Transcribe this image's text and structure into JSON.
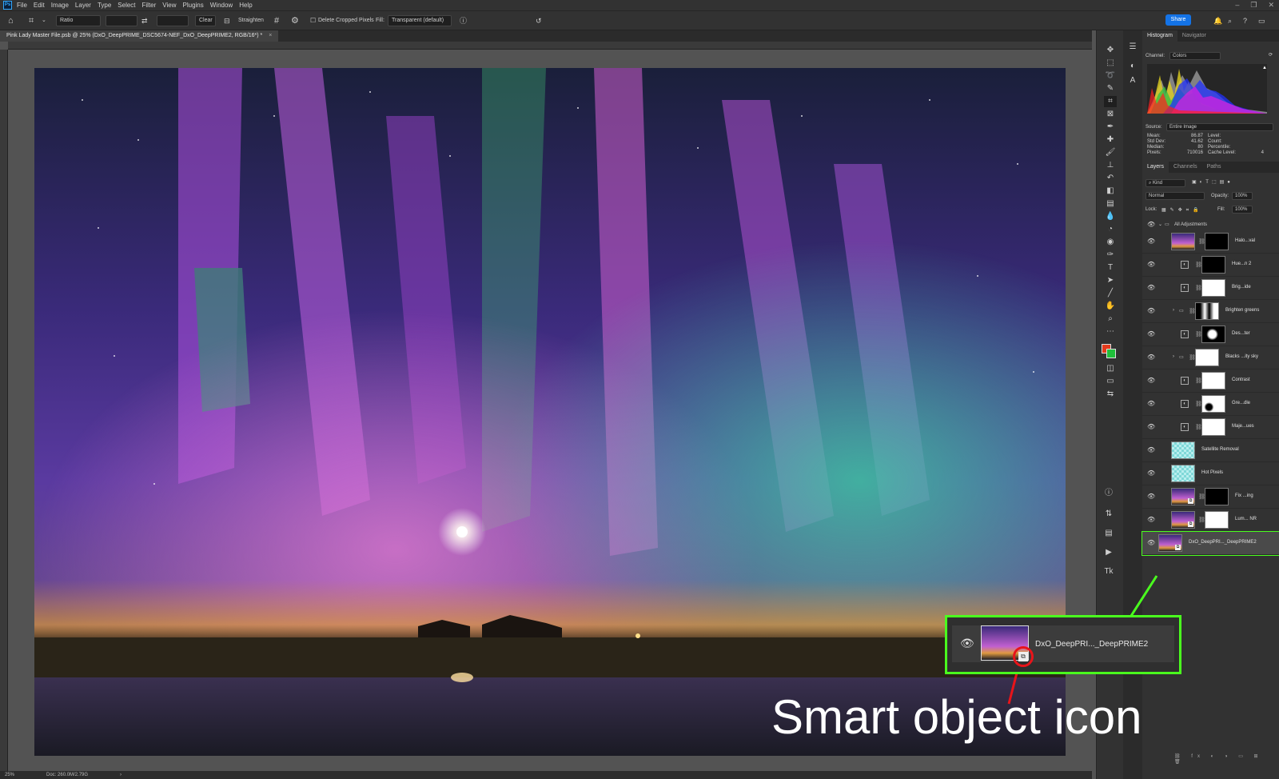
{
  "menubar": {
    "app_icon": "Ps",
    "items": [
      "File",
      "Edit",
      "Image",
      "Layer",
      "Type",
      "Select",
      "Filter",
      "View",
      "Plugins",
      "Window",
      "Help"
    ]
  },
  "options": {
    "ratio": "Ratio",
    "clear": "Clear",
    "straighten": "Straighten",
    "delete_cropped": "Delete Cropped Pixels",
    "fill_label": "Fill:",
    "fill_value": "Transparent (default)",
    "share": "Share"
  },
  "document": {
    "tab_title": "Pink Lady Master File.psb @ 25% (DxO_DeepPRIME_DSC5674-NEF_DxO_DeepPRIME2, RGB/16*) *",
    "close": "×"
  },
  "status": {
    "zoom": "25%",
    "doc": "Doc: 260.0M/2.79G"
  },
  "histogram": {
    "tabs": [
      "Histogram",
      "Navigator"
    ],
    "channel_label": "Channel:",
    "channel": "Colors",
    "source_label": "Source:",
    "source": "Entire Image",
    "stats_left": [
      [
        "Mean:",
        "86.87"
      ],
      [
        "Std Dev:",
        "41.62"
      ],
      [
        "Median:",
        "80"
      ],
      [
        "Pixels:",
        "710016"
      ]
    ],
    "stats_right": [
      [
        "Level:",
        ""
      ],
      [
        "Count:",
        ""
      ],
      [
        "Percentile:",
        ""
      ],
      [
        "Cache Level:",
        "4"
      ]
    ]
  },
  "layers": {
    "tabs": [
      "Layers",
      "Channels",
      "Paths"
    ],
    "filter": "Kind",
    "blend": "Normal",
    "opacity_label": "Opacity:",
    "opacity": "100%",
    "lock_label": "Lock:",
    "fill_label": "Fill:",
    "fill": "100%",
    "group": "All Adjustments",
    "rows": [
      "Halo...val",
      "Hue...n 2",
      "Brig...ide",
      "Brighten greens",
      "Des...ter",
      "Blacks ...ity sky",
      "Contrast",
      "Gre...dle",
      "Maje...ues",
      "Satellite Removal",
      "Hot Pixels",
      "Fix ...ing",
      "Lum... NR",
      "DxO_DeepPRI..._DeepPRIME2"
    ]
  },
  "callout": {
    "layer_name": "DxO_DeepPRI..._DeepPRIME2",
    "label": "Smart object icon"
  },
  "colors": {
    "accent": "#1473e6",
    "callout": "#4aff1e",
    "marker": "#e8141a",
    "foreground": "#e33a1c",
    "background": "#1fbf3a"
  }
}
